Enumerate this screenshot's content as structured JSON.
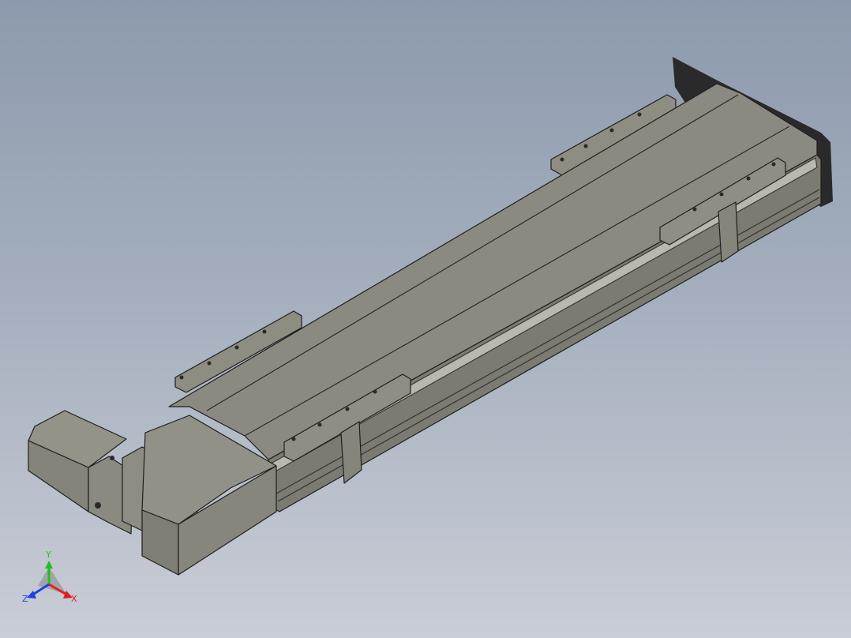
{
  "viewport": {
    "background_top": "#8d9aad",
    "background_bottom": "#c9cdd6"
  },
  "model": {
    "body_color": "#8a8a80",
    "edge_color": "#1e1e1e"
  },
  "triad": {
    "x_label": "X",
    "y_label": "Y",
    "z_label": "Z",
    "x_color": "#e02020",
    "y_color": "#20c020",
    "z_color": "#2040e0"
  }
}
